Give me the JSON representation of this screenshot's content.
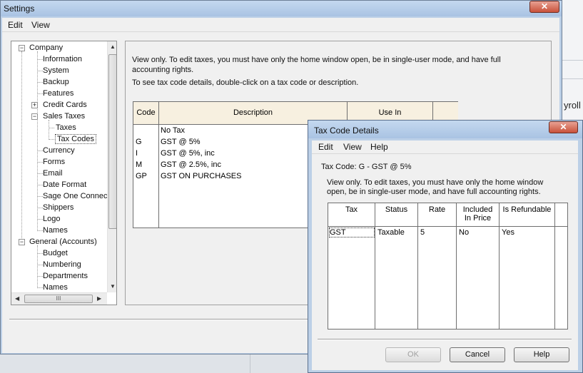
{
  "background": {
    "right_text": "yroll"
  },
  "settings": {
    "title": "Settings",
    "menu": [
      "Edit",
      "View"
    ],
    "tree": {
      "company": "Company",
      "information": "Information",
      "system": "System",
      "backup": "Backup",
      "features": "Features",
      "credit_cards": "Credit Cards",
      "sales_taxes": "Sales Taxes",
      "taxes": "Taxes",
      "tax_codes": "Tax Codes",
      "currency": "Currency",
      "forms": "Forms",
      "email": "Email",
      "date_format": "Date Format",
      "sage_one": "Sage One Connec",
      "shippers": "Shippers",
      "logo": "Logo",
      "names": "Names",
      "general_accounts": "General (Accounts)",
      "budget": "Budget",
      "numbering": "Numbering",
      "departments": "Departments",
      "names2": "Names",
      "hscroll_grip": "III"
    },
    "pane": {
      "line1": "View only. To edit taxes, you must have only the home window open, be in single-user mode, and have full",
      "line2": "accounting rights.",
      "line3": "To see tax code details, double-click on a tax code or description.",
      "columns": [
        "Code",
        "Description",
        "Use In"
      ],
      "rows": [
        {
          "code": "",
          "description": "No Tax"
        },
        {
          "code": "G",
          "description": "GST @ 5%"
        },
        {
          "code": "I",
          "description": "GST @ 5%, inc"
        },
        {
          "code": "M",
          "description": "GST @ 2.5%, inc"
        },
        {
          "code": "GP",
          "description": "GST ON PURCHASES"
        }
      ]
    }
  },
  "dialog": {
    "title": "Tax Code Details",
    "menu": [
      "Edit",
      "View",
      "Help"
    ],
    "tax_code_label": "Tax Code: G - GST @ 5%",
    "info_line1": "View only. To edit taxes, you must have only the home window",
    "info_line2": "open, be in single-user mode, and have full accounting rights.",
    "columns": {
      "tax": "Tax",
      "status": "Status",
      "rate": "Rate",
      "included_1": "Included",
      "included_2": "In Price",
      "refundable": "Is Refundable"
    },
    "row": {
      "tax": "GST",
      "status": "Taxable",
      "rate": "5",
      "included": "No",
      "refundable": "Yes"
    },
    "buttons": {
      "ok": "OK",
      "cancel": "Cancel",
      "help": "Help"
    }
  }
}
